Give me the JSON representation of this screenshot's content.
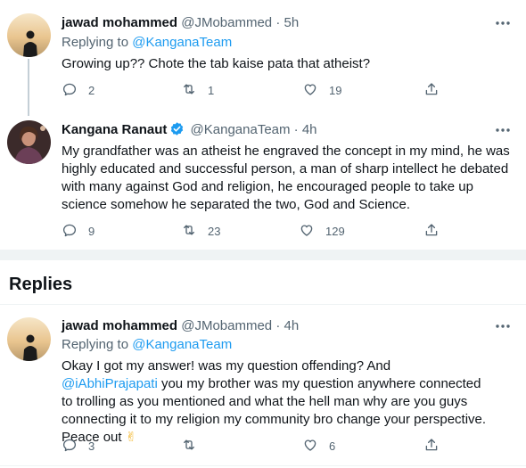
{
  "tweet1": {
    "name": "jawad mohammed",
    "handle": "@JMobammed",
    "dot": "·",
    "time": "5h",
    "replying_prefix": "Replying to ",
    "replying_handle": "@KanganaTeam",
    "text": "Growing up?? Chote the tab kaise pata that atheist?",
    "reply_count": "2",
    "retweet_count": "1",
    "like_count": "19"
  },
  "tweet2": {
    "name": "Kangana Ranaut",
    "handle": "@KanganaTeam",
    "dot": "·",
    "time": "4h",
    "text": "My grandfather was an atheist he engraved the concept in my mind, he was highly educated and successful person, a man of sharp intellect he debated with many against God and religion, he encouraged people to take up science somehow he separated the two, God and Science.",
    "reply_count": "9",
    "retweet_count": "23",
    "like_count": "129"
  },
  "replies_heading": "Replies",
  "tweet3": {
    "name": "jawad mohammed",
    "handle": "@JMobammed",
    "dot": "·",
    "time": "4h",
    "replying_prefix": "Replying to ",
    "replying_handle": "@KanganaTeam",
    "text_before": "Okay I got my answer! was my question offending? And ",
    "mention": "@iAbhiPrajapati",
    "text_after": " you my brother was my question anywhere connected to trolling as you mentioned and what the hell man why are you guys connecting it to my religion my community bro change your perspective. Peace out ",
    "emoji": "✌",
    "reply_count": "3",
    "like_count": "6"
  },
  "colors": {
    "text": "#0f1419",
    "secondary": "#536471",
    "link": "#1d9bf0",
    "verified": "#1d9bf0",
    "divider": "#eff3f4"
  },
  "icons": [
    "reply-icon",
    "retweet-icon",
    "like-icon",
    "share-icon",
    "more-icon",
    "verified-icon"
  ]
}
